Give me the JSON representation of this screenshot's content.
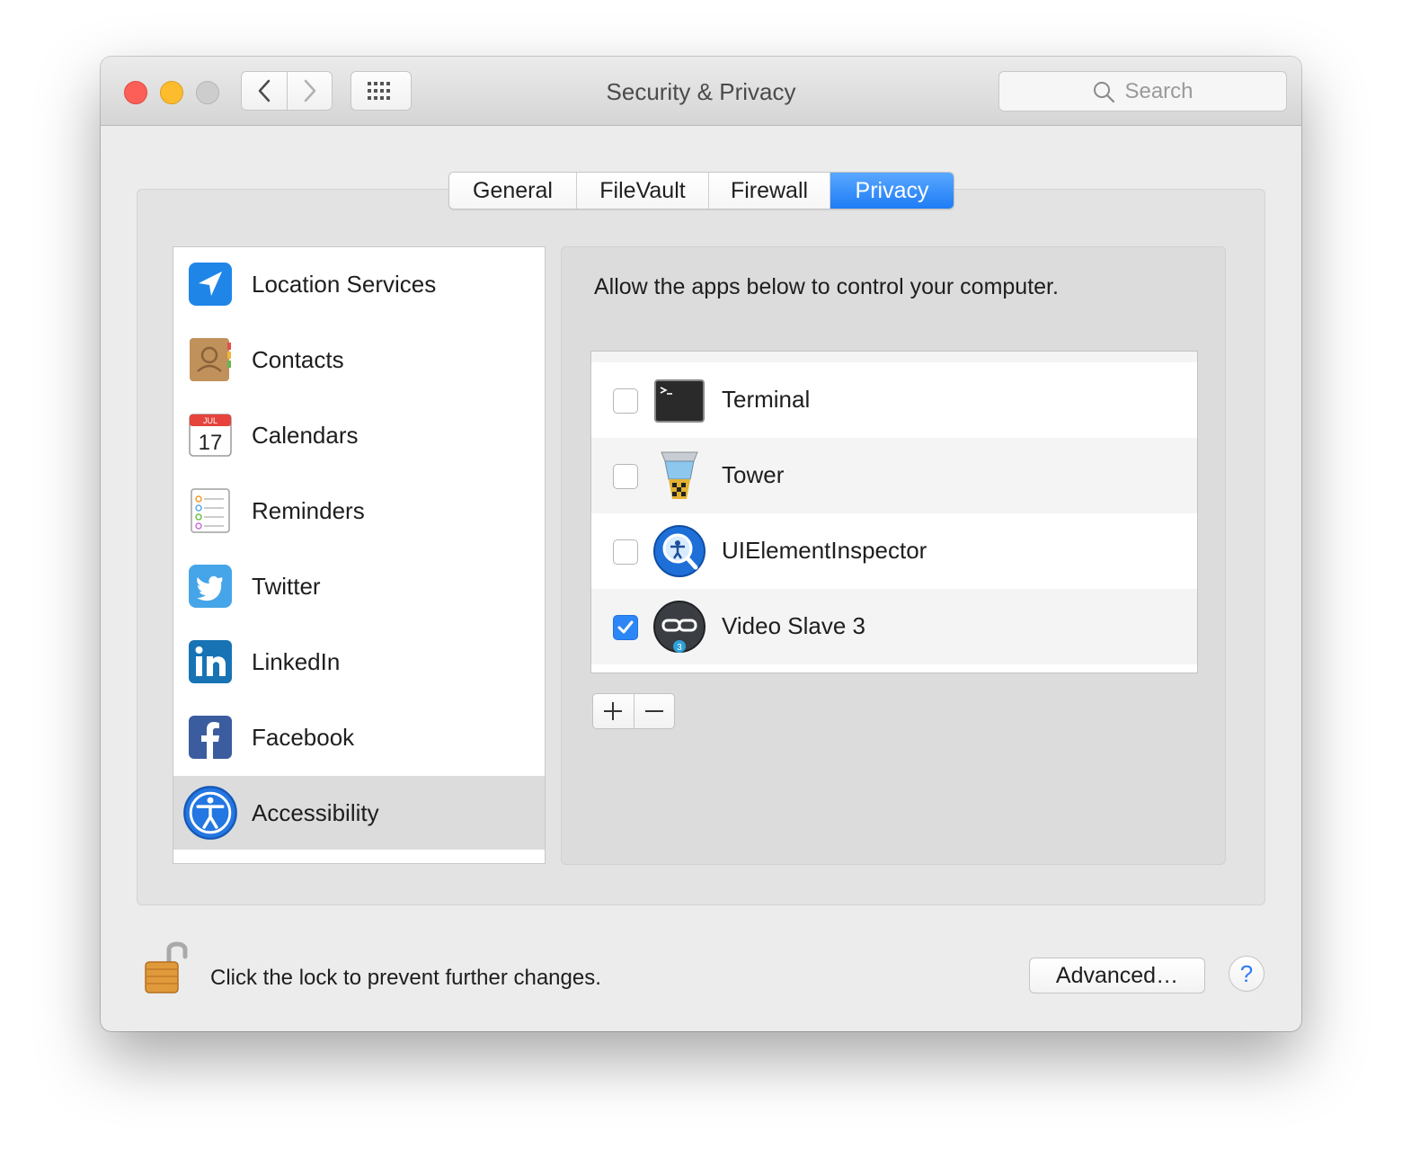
{
  "window": {
    "title": "Security & Privacy",
    "search_placeholder": "Search"
  },
  "tabs": [
    {
      "label": "General",
      "active": false
    },
    {
      "label": "FileVault",
      "active": false
    },
    {
      "label": "Firewall",
      "active": false
    },
    {
      "label": "Privacy",
      "active": true
    }
  ],
  "categories": [
    {
      "label": "Location Services",
      "icon": "location-arrow-icon"
    },
    {
      "label": "Contacts",
      "icon": "contacts-book-icon"
    },
    {
      "label": "Calendars",
      "icon": "calendar-icon",
      "icon_month": "JUL",
      "icon_day": "17"
    },
    {
      "label": "Reminders",
      "icon": "reminders-icon"
    },
    {
      "label": "Twitter",
      "icon": "twitter-bird-icon"
    },
    {
      "label": "LinkedIn",
      "icon": "linkedin-icon"
    },
    {
      "label": "Facebook",
      "icon": "facebook-icon"
    },
    {
      "label": "Accessibility",
      "icon": "accessibility-icon",
      "selected": true
    }
  ],
  "accessibility_panel": {
    "description": "Allow the apps below to control your computer.",
    "apps": [
      {
        "name": "Terminal",
        "checked": false,
        "icon": "terminal-icon"
      },
      {
        "name": "Tower",
        "checked": false,
        "icon": "tower-icon"
      },
      {
        "name": "UIElementInspector",
        "checked": false,
        "icon": "ui-element-inspector-icon"
      },
      {
        "name": "Video Slave 3",
        "checked": true,
        "icon": "video-slave-icon",
        "badge": "3"
      }
    ],
    "add_symbol": "+",
    "remove_symbol": "−"
  },
  "footer": {
    "lock_text": "Click the lock to prevent further changes.",
    "advanced_label": "Advanced…",
    "help_symbol": "?"
  },
  "colors": {
    "accent": "#1e7cf5",
    "close": "#fc5f57",
    "minimize": "#fdbc2e",
    "zoom": "#cdcdcd"
  }
}
